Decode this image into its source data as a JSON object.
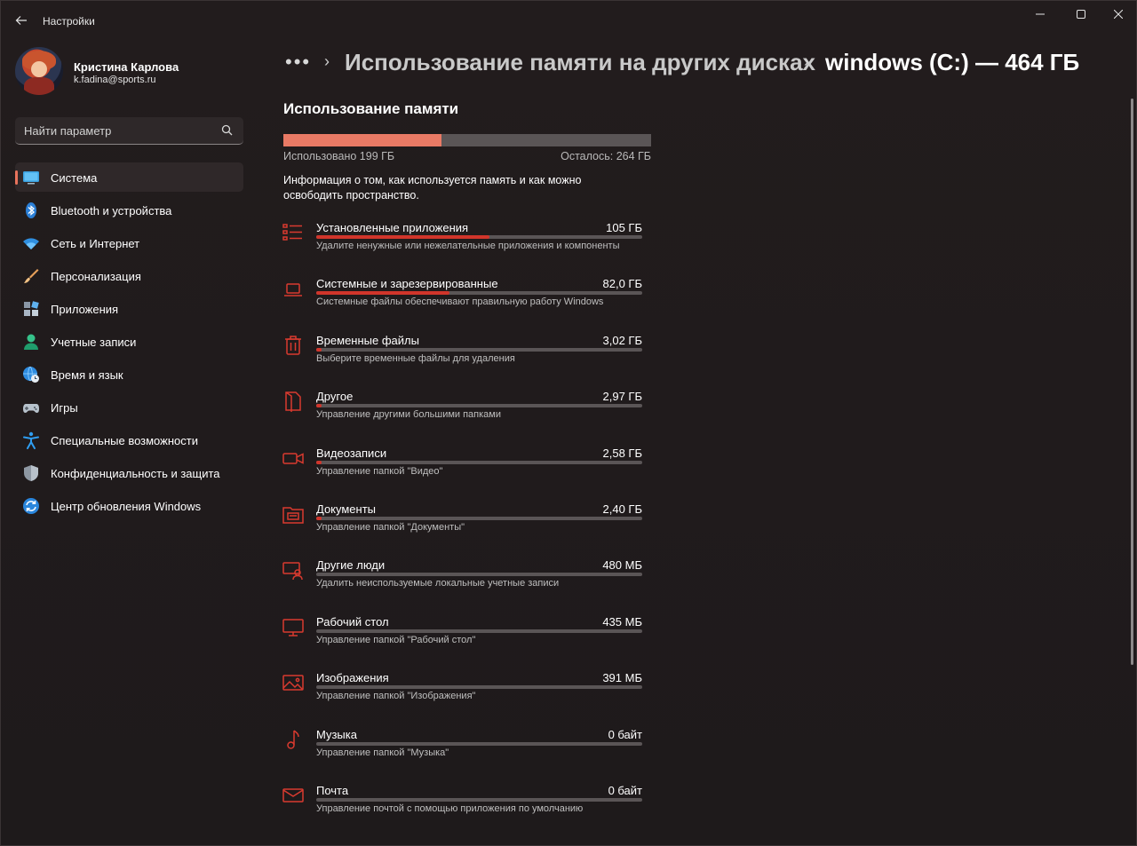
{
  "window": {
    "title": "Настройки",
    "controls": {
      "minimize": "─",
      "maximize": "☐",
      "close": "✕"
    }
  },
  "profile": {
    "name": "Кристина Карлова",
    "email": "k.fadina@sports.ru"
  },
  "search": {
    "placeholder": "Найти параметр"
  },
  "sidebar": {
    "items": [
      {
        "label": "Система",
        "icon": "system-icon",
        "active": true
      },
      {
        "label": "Bluetooth и устройства",
        "icon": "bluetooth-icon"
      },
      {
        "label": "Сеть и Интернет",
        "icon": "wifi-icon"
      },
      {
        "label": "Персонализация",
        "icon": "brush-icon"
      },
      {
        "label": "Приложения",
        "icon": "apps-icon"
      },
      {
        "label": "Учетные записи",
        "icon": "person-icon"
      },
      {
        "label": "Время и язык",
        "icon": "globe-clock-icon"
      },
      {
        "label": "Игры",
        "icon": "gamepad-icon"
      },
      {
        "label": "Специальные возможности",
        "icon": "accessibility-icon"
      },
      {
        "label": "Конфиденциальность и защита",
        "icon": "shield-icon"
      },
      {
        "label": "Центр обновления Windows",
        "icon": "update-icon"
      }
    ]
  },
  "breadcrumb": {
    "overflow": "•••",
    "parent": "Использование памяти на других дисках",
    "current": "windows (C:) — 464 ГБ"
  },
  "storage": {
    "title": "Использование памяти",
    "used_label": "Использовано 199 ГБ",
    "free_label": "Осталось: 264 ГБ",
    "used_fraction": 0.429,
    "info": "Информация о том, как используется память и как можно освободить пространство."
  },
  "categories": [
    {
      "name": "Установленные приложения",
      "size": "105 ГБ",
      "desc": "Удалите ненужные или нежелательные приложения и компоненты",
      "fraction": 0.53,
      "icon": "apps-list-icon"
    },
    {
      "name": "Системные и зарезервированные",
      "size": "82,0 ГБ",
      "desc": "Системные файлы обеспечивают правильную работу Windows",
      "fraction": 0.41,
      "icon": "laptop-icon"
    },
    {
      "name": "Временные файлы",
      "size": "3,02 ГБ",
      "desc": "Выберите временные файлы для удаления",
      "fraction": 0.016,
      "icon": "trash-icon"
    },
    {
      "name": "Другое",
      "size": "2,97 ГБ",
      "desc": "Управление другими большими папками",
      "fraction": 0.015,
      "icon": "document-icon"
    },
    {
      "name": "Видеозаписи",
      "size": "2,58 ГБ",
      "desc": "Управление папкой \"Видео\"",
      "fraction": 0.013,
      "icon": "video-icon"
    },
    {
      "name": "Документы",
      "size": "2,40 ГБ",
      "desc": "Управление папкой \"Документы\"",
      "fraction": 0.012,
      "icon": "documents-folder-icon"
    },
    {
      "name": "Другие люди",
      "size": "480 МБ",
      "desc": "Удалить неиспользуемые локальные учетные записи",
      "fraction": 0.0,
      "icon": "people-icon"
    },
    {
      "name": "Рабочий стол",
      "size": "435 МБ",
      "desc": "Управление папкой \"Рабочий стол\"",
      "fraction": 0.0,
      "icon": "desktop-icon"
    },
    {
      "name": "Изображения",
      "size": "391 МБ",
      "desc": "Управление папкой \"Изображения\"",
      "fraction": 0.0,
      "icon": "image-icon"
    },
    {
      "name": "Музыка",
      "size": "0 байт",
      "desc": "Управление папкой \"Музыка\"",
      "fraction": 0.0,
      "icon": "music-icon"
    },
    {
      "name": "Почта",
      "size": "0 байт",
      "desc": "Управление почтой с помощью приложения по умолчанию",
      "fraction": 0.0,
      "icon": "mail-icon"
    }
  ],
  "colors": {
    "accent": "#e8735c",
    "usage_fill": "#e97a65",
    "category_fill": "#d1352b",
    "icon_red": "#d93a2f"
  }
}
